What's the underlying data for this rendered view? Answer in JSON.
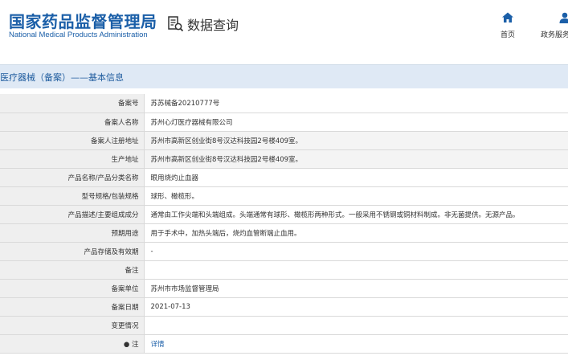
{
  "header": {
    "brand_cn": "国家药品监督管理局",
    "brand_en": "National Medical Products Administration",
    "query_label": "数据查询",
    "query_icon": "document-search-icon",
    "nav": [
      {
        "label": "首页",
        "icon": "home-icon"
      },
      {
        "label": "政务服务",
        "icon": "user-icon"
      }
    ]
  },
  "section": {
    "title": "医疗器械（备案）——基本信息"
  },
  "details": [
    {
      "label": "备案号",
      "value": "苏苏械备20210777号"
    },
    {
      "label": "备案人名称",
      "value": "苏州心灯医疗器械有限公司"
    },
    {
      "label": "备案人注册地址",
      "value": "苏州市高新区创业街8号汉达科技园2号楼409室。"
    },
    {
      "label": "生产地址",
      "value": "苏州市高新区创业街8号汉达科技园2号楼409室。"
    },
    {
      "label": "产品名称/产品分类名称",
      "value": "眼用烧灼止血器"
    },
    {
      "label": "型号规格/包装规格",
      "value": "球形、橄榄形。"
    },
    {
      "label": "产品描述/主要组成成分",
      "value": "通常由工作尖端和头端组成。头端通常有球形、橄榄形两种形式。一般采用不锈钢或铜材料制成。非无菌提供。无源产品。"
    },
    {
      "label": "预期用途",
      "value": "用于手术中，加热头端后，烧灼血管断端止血用。"
    },
    {
      "label": "产品存储及有效期",
      "value": "-"
    },
    {
      "label": "备注",
      "value": ""
    },
    {
      "label": "备案单位",
      "value": "苏州市市场监督管理局"
    },
    {
      "label": "备案日期",
      "value": "2021-07-13"
    },
    {
      "label": "变更情况",
      "value": ""
    },
    {
      "label": "注",
      "value": "详情"
    }
  ],
  "colors": {
    "brand_blue": "#1b5fa8",
    "section_bg": "#dfe9f5",
    "label_bg": "#efefef",
    "link": "#1b5fa8"
  }
}
